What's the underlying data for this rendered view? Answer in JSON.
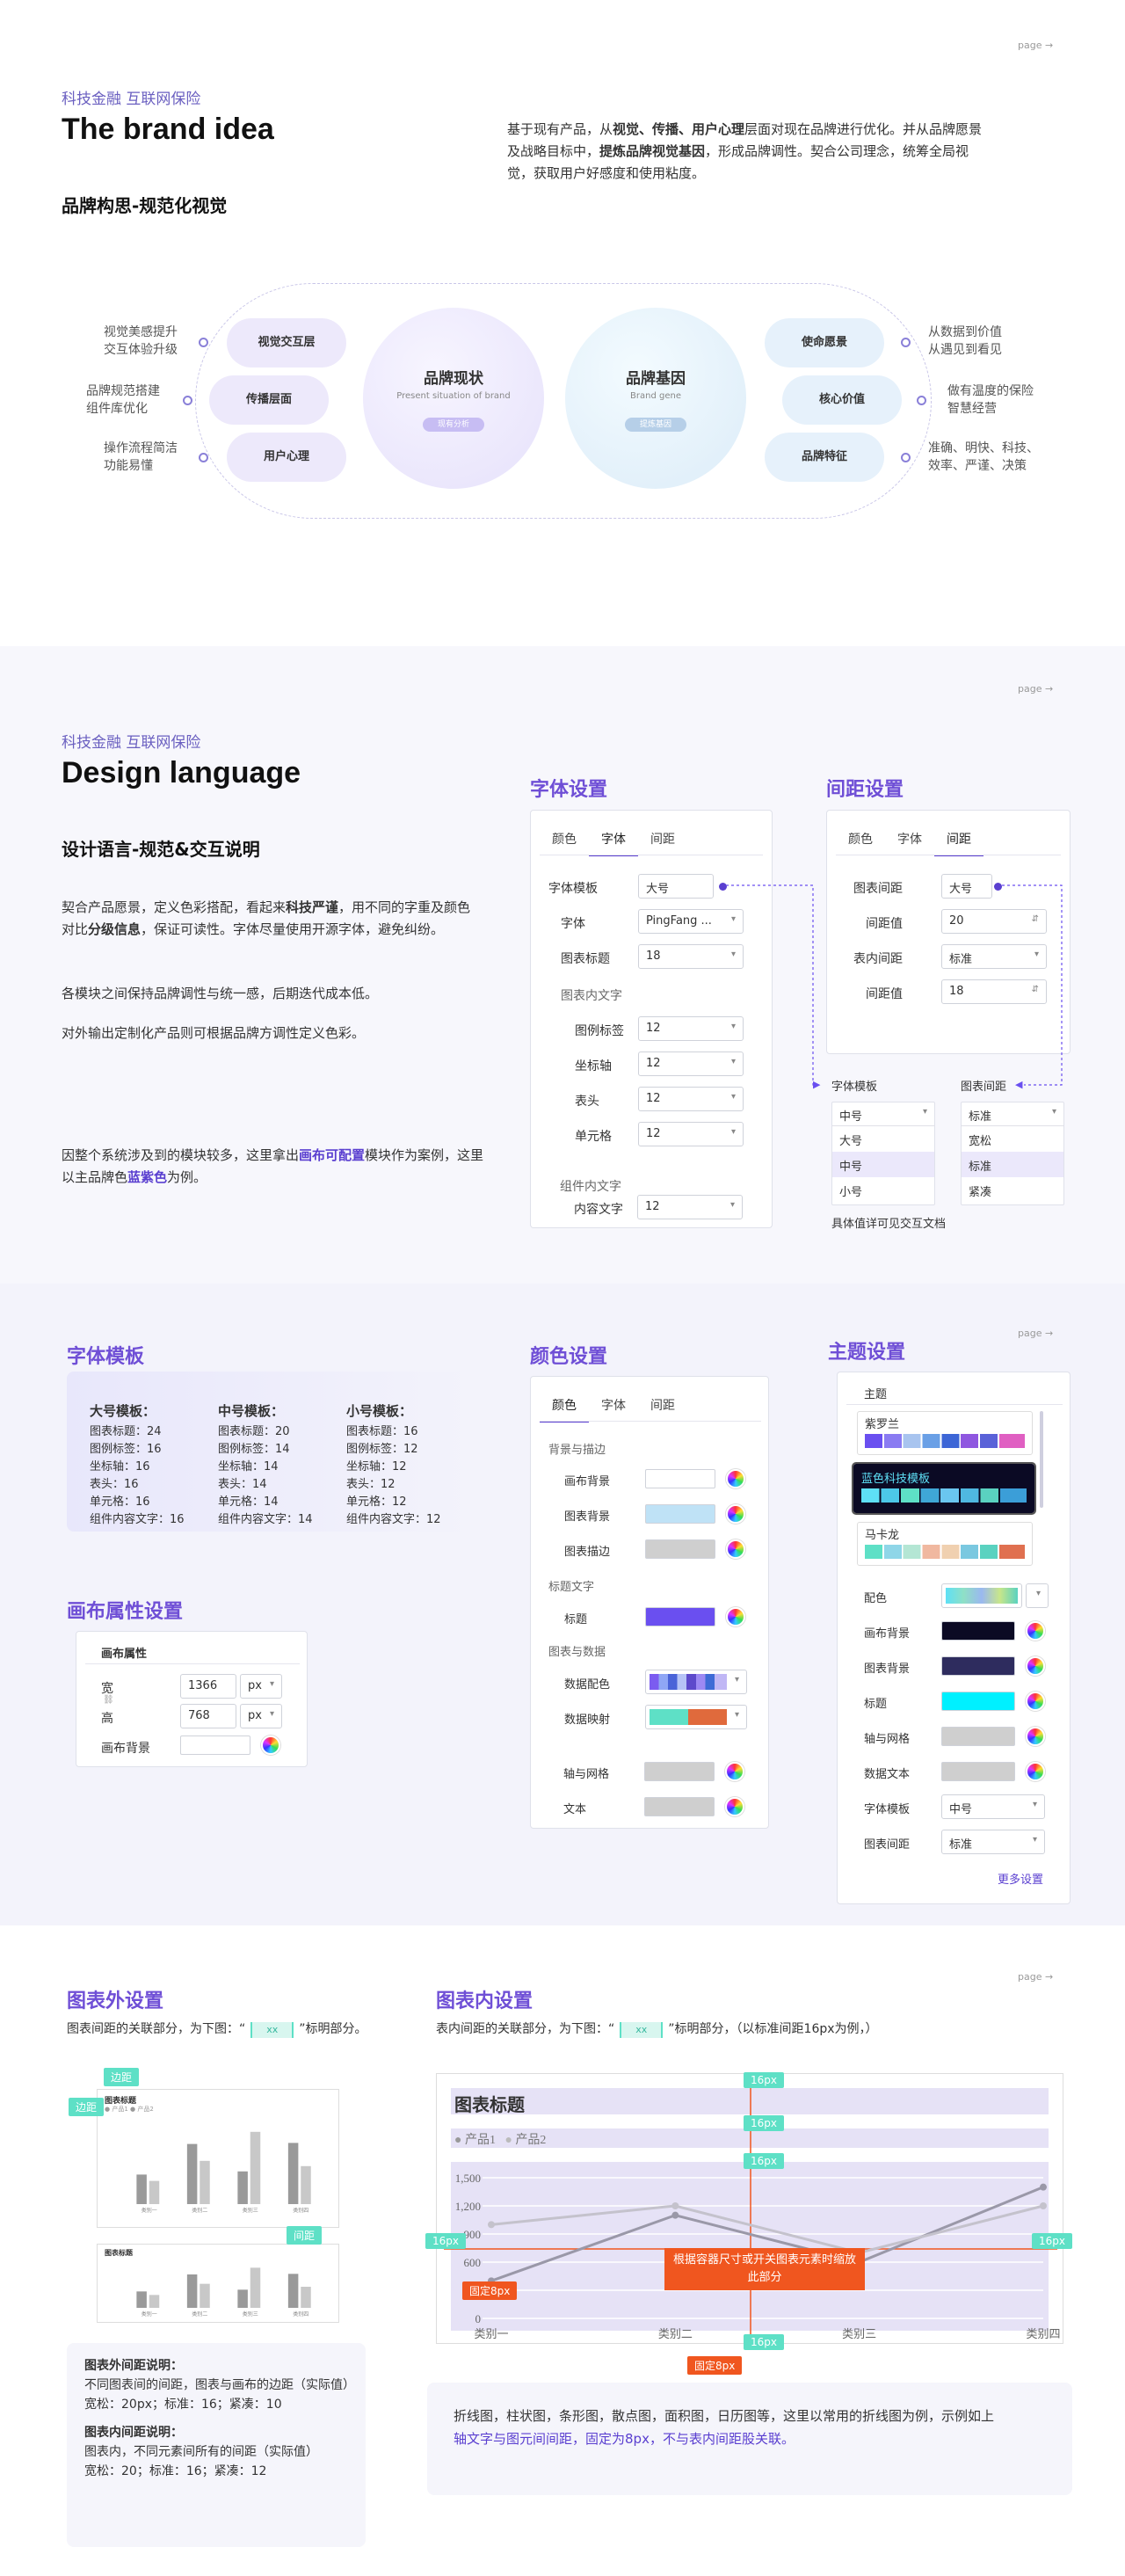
{
  "s1": {
    "tag": "科技金融 互联网保险",
    "page": "page →",
    "title": "The brand idea",
    "subtitle": "品牌构思-规范化视觉",
    "desc_parts": [
      "基于现有产品，从",
      "视觉、传播、用户心理",
      "层面对现在品牌进行优化。并从品牌愿景及战略目标中，",
      "提炼品牌视觉基因",
      "，形成品牌调性。契合公司理念，统筹全局视觉，获取用户好感度和使用粘度。"
    ],
    "circle1": {
      "title": "品牌现状",
      "sub": "Present situation of brand",
      "badge": "现有分析"
    },
    "circle2": {
      "title": "品牌基因",
      "sub": "Brand gene",
      "badge": "提炼基因"
    },
    "left_pills": [
      "视觉交互层",
      "传播层面",
      "用户心理"
    ],
    "right_pills": [
      "使命愿景",
      "核心价值",
      "品牌特征"
    ],
    "left_labels": [
      [
        "视觉美感提升",
        "交互体验升级"
      ],
      [
        "品牌规范搭建",
        "组件库优化"
      ],
      [
        "操作流程简洁",
        "功能易懂"
      ]
    ],
    "right_labels": [
      [
        "从数据到价值",
        "从遇见到看见"
      ],
      [
        "做有温度的保险",
        "智慧经营"
      ],
      [
        "准确、明快、科技、",
        "效率、严谨、决策"
      ]
    ]
  },
  "s2": {
    "tag": "科技金融 互联网保险",
    "page": "page →",
    "title": "Design language",
    "subtitle": "设计语言-规范&交互说明",
    "p1_parts": [
      "契合产品愿景，定义色彩搭配，看起来",
      "科技严谨",
      "，用不同的字重及颜色对比",
      "分级信息",
      "，保证可读性。字体尽量使用开源字体，避免纠纷。"
    ],
    "p2": "各模块之间保持品牌调性与统一感，后期迭代成本低。",
    "p3": "对外输出定制化产品则可根据品牌方调性定义色彩。",
    "p4_parts": [
      "因整个系统涉及到的模块较多，这里拿出",
      "画布可配置",
      "模块作为案例，这里以主品牌色",
      "蓝紫色",
      "为例。"
    ],
    "font_title": "字体设置",
    "space_title": "间距设置",
    "tabs": [
      "颜色",
      "字体",
      "间距"
    ],
    "font_rows": [
      {
        "label": "字体模板",
        "value": "大号"
      },
      {
        "label": "字体",
        "value": "PingFang ..."
      },
      {
        "label": "图表标题",
        "value": "18"
      }
    ],
    "group1": "图表内文字",
    "font_rows2": [
      {
        "label": "图例标签",
        "value": "12"
      },
      {
        "label": "坐标轴",
        "value": "12"
      },
      {
        "label": "表头",
        "value": "12"
      },
      {
        "label": "单元格",
        "value": "12"
      }
    ],
    "group2": "组件内文字",
    "font_rows3": [
      {
        "label": "内容文字",
        "value": "12"
      }
    ],
    "space_rows": [
      {
        "label": "图表间距",
        "value": "大号"
      },
      {
        "label": "间距值",
        "value": "20"
      },
      {
        "label": "表内间距",
        "value": "标准"
      },
      {
        "label": "间距值",
        "value": "18"
      }
    ],
    "dd1": {
      "label": "字体模板",
      "current": "中号",
      "options": [
        "大号",
        "中号",
        "小号"
      ]
    },
    "dd2": {
      "label": "图表间距",
      "current": "标准",
      "options": [
        "宽松",
        "标准",
        "紧凑"
      ]
    },
    "note": "具体值详可见交互文档"
  },
  "s3": {
    "page": "page →",
    "tpl_title": "字体模板",
    "tpls": [
      {
        "name": "大号模板：",
        "lines": [
          "图表标题：24",
          "图例标签：16",
          "坐标轴：16",
          "表头：16",
          "单元格：16",
          "组件内容文字：16"
        ]
      },
      {
        "name": "中号模板：",
        "lines": [
          "图表标题：20",
          "图例标签：14",
          "坐标轴：14",
          "表头：14",
          "单元格：14",
          "组件内容文字：14"
        ]
      },
      {
        "name": "小号模板：",
        "lines": [
          "图表标题：16",
          "图例标签：12",
          "坐标轴：12",
          "表头：12",
          "单元格：12",
          "组件内容文字：12"
        ]
      }
    ],
    "canvas_title": "画布属性设置",
    "canvas_head": "画布属性",
    "w_label": "宽",
    "h_label": "高",
    "w": "1366",
    "h": "768",
    "unit": "px",
    "bg_label": "画布背景",
    "color_title": "颜色设置",
    "g_bg": "背景与描边",
    "bg_rows": [
      "画布背景",
      "图表背景",
      "图表描边"
    ],
    "g_title": "标题文字",
    "title_row": "标题",
    "g_data": "图表与数据",
    "data_rows": [
      "数据配色",
      "数据映射",
      "轴与网格",
      "文本"
    ],
    "theme_title": "主题设置",
    "theme_head": "主题",
    "themes": [
      "紫罗兰",
      "蓝色科技模板",
      "马卡龙"
    ],
    "theme_rows": [
      "配色",
      "画布背景",
      "图表背景",
      "标题",
      "轴与网格",
      "数据文本",
      "字体模板",
      "图表间距"
    ],
    "theme_font": "中号",
    "theme_space": "标准",
    "more": "更多设置",
    "colors": {
      "accent": "#5a3fd0",
      "purple_bg": "#6a4ff0",
      "teal": "#5ee0c6"
    }
  },
  "s4": {
    "page": "page →",
    "out_title": "图表外设置",
    "out_desc1": "图表间距的关联部分，为下图：“",
    "out_desc2": "”标明部分。",
    "xx": "xx",
    "edge1": "边距",
    "edge2": "边距",
    "gap": "间距",
    "notes_h1": "图表外间距说明：",
    "notes_b1": "不同图表间的间距，图表与画布的边距（实际值）",
    "notes_v1": "宽松：20px；标准：16；紧凑：10",
    "notes_h2": "图表内间距说明：",
    "notes_b2": "图表内，不同元素间所有的间距（实际值）",
    "notes_v2": "宽松：20；标准：16；紧凑：12",
    "in_title": "图表内设置",
    "in_desc1": "表内间距的关联部分，为下图：“",
    "in_desc2": "”标明部分，（以标准间距16px为例，）",
    "bottom1": "折线图，柱状图，条形图，散点图，面积图，日历图等，这里以常用的折线图为例，示例如上",
    "bottom2": "轴文字与图元间间距，固定为8px，不与表内间距股关联。",
    "marks": [
      "16px",
      "16px",
      "16px",
      "16px",
      "16px",
      "16px"
    ],
    "fixed8": "固定8px",
    "fixed8b": "固定8px",
    "callout": "根据容器尺寸或开关图表元素时缩放此部分"
  },
  "chart_data": {
    "type": "line",
    "title": "图表标题",
    "categories": [
      "类别一",
      "类别二",
      "类别三",
      "类别四"
    ],
    "series": [
      {
        "name": "产品1",
        "values": [
          400,
          1100,
          600,
          1400
        ]
      },
      {
        "name": "产品2",
        "values": [
          1000,
          1200,
          700,
          1200
        ]
      }
    ],
    "yticks": [
      0,
      300,
      600,
      900,
      1200,
      1500
    ],
    "ylim": [
      0,
      1500
    ]
  },
  "mini_chart": {
    "title": "图表标题",
    "legend": [
      "产品1",
      "产品2"
    ],
    "categories": [
      "类别一",
      "类别二",
      "类别三",
      "类别四"
    ],
    "values": [
      [
        560,
        1140,
        620,
        1160
      ],
      [
        440,
        820,
        1370,
        720
      ]
    ]
  }
}
